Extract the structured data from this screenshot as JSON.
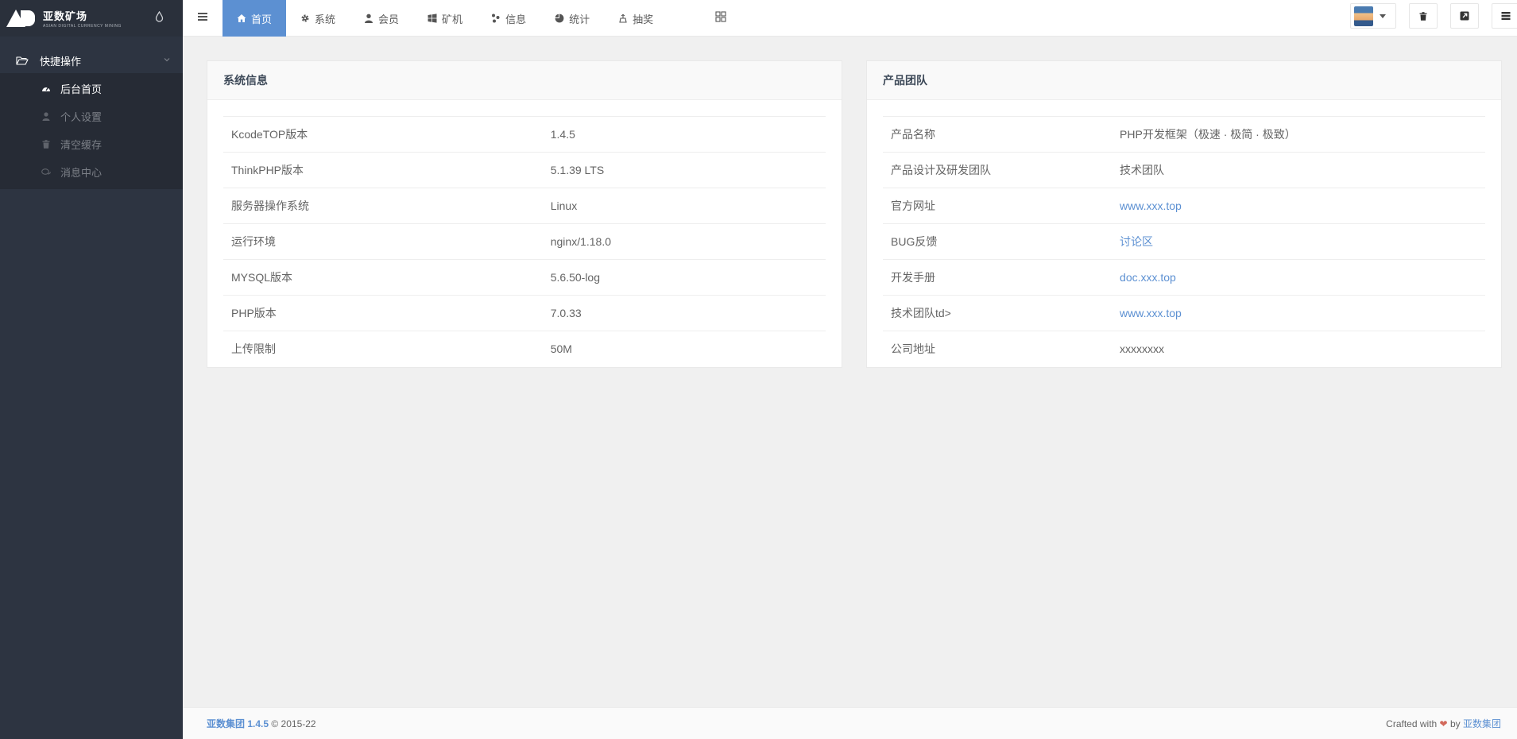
{
  "sidebar": {
    "logo_title": "亚数矿场",
    "logo_subtitle": "ASIAN DIGITAL CURRENCY MINING",
    "group_label": "快捷操作",
    "items": [
      {
        "label": "后台首页",
        "icon": "dashboard-icon",
        "active": true
      },
      {
        "label": "个人设置",
        "icon": "user-icon",
        "active": false
      },
      {
        "label": "清空缓存",
        "icon": "trash-icon",
        "active": false
      },
      {
        "label": "消息中心",
        "icon": "chat-icon",
        "active": false
      }
    ]
  },
  "topbar": {
    "tabs": [
      {
        "label": "首页",
        "icon": "home-icon",
        "active": true
      },
      {
        "label": "系统",
        "icon": "gear-icon",
        "active": false
      },
      {
        "label": "会员",
        "icon": "user-icon",
        "active": false
      },
      {
        "label": "矿机",
        "icon": "windows-icon",
        "active": false
      },
      {
        "label": "信息",
        "icon": "info-icon",
        "active": false
      },
      {
        "label": "统计",
        "icon": "pie-chart-icon",
        "active": false
      },
      {
        "label": "抽奖",
        "icon": "lottery-icon",
        "active": false
      }
    ]
  },
  "system_panel": {
    "title": "系统信息",
    "rows": [
      {
        "key": "KcodeTOP版本",
        "value": "1.4.5"
      },
      {
        "key": "ThinkPHP版本",
        "value": "5.1.39 LTS"
      },
      {
        "key": "服务器操作系统",
        "value": "Linux"
      },
      {
        "key": "运行环境",
        "value": "nginx/1.18.0"
      },
      {
        "key": "MYSQL版本",
        "value": "5.6.50-log"
      },
      {
        "key": "PHP版本",
        "value": "7.0.33"
      },
      {
        "key": "上传限制",
        "value": "50M"
      }
    ]
  },
  "team_panel": {
    "title": "产品团队",
    "rows": [
      {
        "key": "产品名称",
        "value": "PHP开发框架（极速 · 极简 · 极致）",
        "link": false
      },
      {
        "key": "产品设计及研发团队",
        "value": "技术团队",
        "link": false
      },
      {
        "key": "官方网址",
        "value": "www.xxx.top",
        "link": true
      },
      {
        "key": "BUG反馈",
        "value": "讨论区",
        "link": true
      },
      {
        "key": "开发手册",
        "value": "doc.xxx.top",
        "link": true
      },
      {
        "key": "技术团队td>",
        "value": "www.xxx.top",
        "link": true
      },
      {
        "key": "公司地址",
        "value": "xxxxxxxx",
        "link": false
      }
    ]
  },
  "footer": {
    "brand": "亚数集团 1.4.5",
    "copyright": "© 2015-22",
    "crafted_prefix": "Crafted with",
    "crafted_by": "by",
    "crafted_author": "亚数集团"
  },
  "colors": {
    "accent": "#5c90d2",
    "sidebar": "#2d3441",
    "heart": "#d26a5c"
  }
}
